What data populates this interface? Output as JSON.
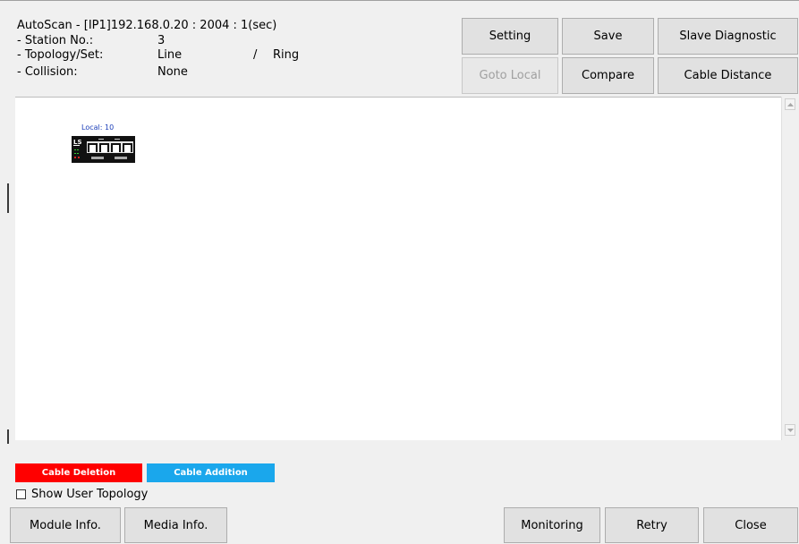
{
  "header": {
    "title": "AutoScan - [IP1]192.168.0.20 : 2004 : 1(sec)",
    "station_label": "- Station No.:",
    "station_value": "3",
    "topology_label": "- Topology/Set:",
    "topology_value": "Line",
    "topology_sep": "/",
    "topology_set": "Ring",
    "collision_label": "- Collision:",
    "collision_value": "None"
  },
  "toolbar": {
    "setting": "Setting",
    "save": "Save",
    "slave_diagnostic": "Slave Diagnostic",
    "goto_local": "Goto Local",
    "compare": "Compare",
    "cable_distance": "Cable Distance"
  },
  "topology_view": {
    "module_label": "Local: 10",
    "module_brand": "LS"
  },
  "legend": {
    "cable_deletion": "Cable Deletion",
    "cable_addition": "Cable Addition",
    "deletion_color": "#ff0000",
    "addition_color": "#1aa7ec"
  },
  "options": {
    "show_user_topology": "Show User Topology",
    "show_user_topology_checked": false
  },
  "footer": {
    "module_info": "Module Info.",
    "media_info": "Media Info.",
    "monitoring": "Monitoring",
    "retry": "Retry",
    "close": "Close"
  }
}
